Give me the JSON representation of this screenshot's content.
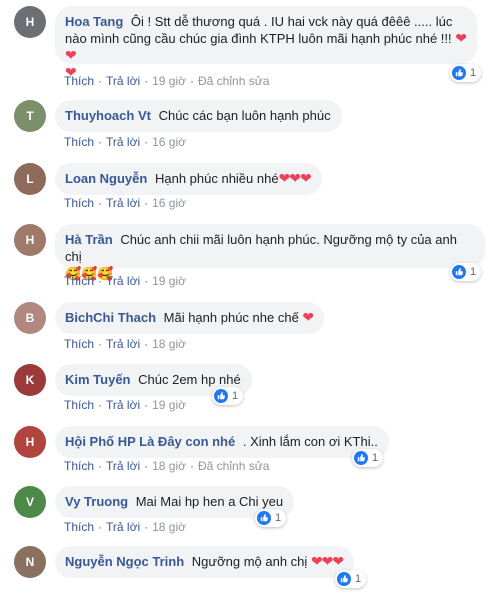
{
  "labels": {
    "like": "Thích",
    "reply": "Trả lời",
    "edited": "Đã chỉnh sửa",
    "sep": "·"
  },
  "comments": [
    {
      "author": "Hoa Tang",
      "text": "Ôi ! Stt dễ thương quá . IU hai vck này quá đêêê ..... lúc nào mình cũng cầu chúc gia đình KTPH luôn mãi hạnh phúc nhé !!!",
      "hearts": "❤❤",
      "hearts_line2": "❤",
      "time": "19 giờ",
      "edited": true,
      "reactions": "1",
      "avatar_color": "#6b6f73",
      "avatar_initial": "H"
    },
    {
      "author": "Thuyhoach Vt",
      "text": "Chúc các bạn luôn hạnh phúc",
      "hearts": "",
      "time": "16 giờ",
      "edited": false,
      "reactions": "",
      "avatar_color": "#7a8f6a",
      "avatar_initial": "T"
    },
    {
      "author": "Loan Nguyễn",
      "text": "Hạnh phúc nhiều nhé",
      "hearts": "❤❤❤",
      "time": "16 giờ",
      "edited": false,
      "reactions": "",
      "avatar_color": "#8e6a5a",
      "avatar_initial": "L"
    },
    {
      "author": "Hà Trần",
      "text": "Chúc anh chii mãi luôn hạnh phúc. Ngưỡng mộ ty của anh chị",
      "faces": "🥰🥰🥰",
      "time": "19 giờ",
      "edited": false,
      "reactions": "1",
      "avatar_color": "#a07a68",
      "avatar_initial": "H"
    },
    {
      "author": "BichChi Thach",
      "text": "Mãi hạnh phúc nhe chế",
      "hearts": "❤",
      "time": "18 giờ",
      "edited": false,
      "reactions": "",
      "avatar_color": "#b08880",
      "avatar_initial": "B"
    },
    {
      "author": "Kim Tuyến",
      "text": "Chúc 2em hp nhé",
      "hearts": "",
      "time": "19 giờ",
      "edited": false,
      "reactions": "1",
      "avatar_color": "#9b3a3a",
      "avatar_initial": "K"
    },
    {
      "author": "Hội Phố HP Là Đây con nhé",
      "text": ". Xinh lắm con ơi KThi..",
      "hearts": "",
      "time": "18 giờ",
      "edited": true,
      "reactions": "1",
      "avatar_color": "#b0453f",
      "avatar_initial": "H"
    },
    {
      "author": "Vy Truong",
      "text": "Mai Mai hp hen a Chi yeu",
      "hearts": "",
      "time": "18 giờ",
      "edited": false,
      "reactions": "1",
      "avatar_color": "#4d8a4a",
      "avatar_initial": "V"
    },
    {
      "author": "Nguyễn Ngọc Trinh",
      "text": "Ngưỡng mộ anh chị",
      "hearts": "❤❤❤",
      "time": "",
      "edited": false,
      "reactions": "1",
      "avatar_color": "#8a7060",
      "avatar_initial": "N"
    }
  ],
  "colors": {
    "author": "#385898",
    "bubble": "#f2f3f5",
    "heart": "#f33e58",
    "like_blue": "#2078f4"
  }
}
